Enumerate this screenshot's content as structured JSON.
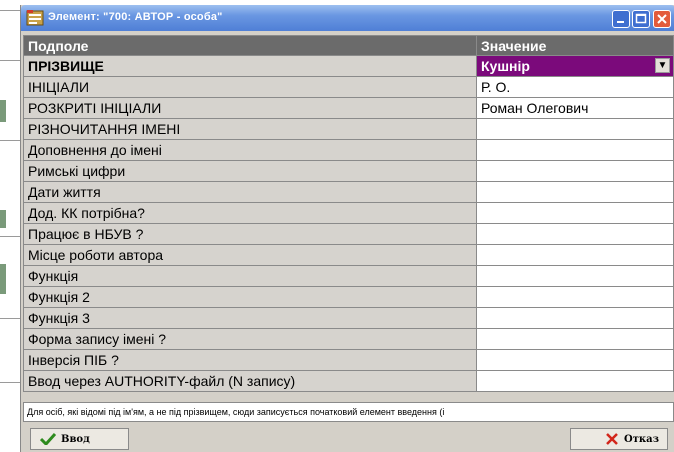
{
  "window": {
    "title": "Элемент: \"700: АВТОР - особа\""
  },
  "table": {
    "headers": {
      "field": "Подполе",
      "value": "Значение"
    },
    "rows": [
      {
        "field": "ПРІЗВИЩЕ",
        "value": "Кушнір"
      },
      {
        "field": "ІНІЦІАЛИ",
        "value": "Р. О."
      },
      {
        "field": "РОЗКРИТІ ІНІЦІАЛИ",
        "value": "Роман Олегович"
      },
      {
        "field": "РІЗНОЧИТАННЯ ІМЕНІ",
        "value": ""
      },
      {
        "field": "Доповнення до імені",
        "value": ""
      },
      {
        "field": "Римські цифри",
        "value": ""
      },
      {
        "field": "Дати життя",
        "value": ""
      },
      {
        "field": "Дод. КК потрібна?",
        "value": ""
      },
      {
        "field": "Працює в НБУВ ?",
        "value": ""
      },
      {
        "field": "Місце роботи автора",
        "value": ""
      },
      {
        "field": "Функція",
        "value": ""
      },
      {
        "field": "Функція 2",
        "value": ""
      },
      {
        "field": "Функція 3",
        "value": ""
      },
      {
        "field": "Форма запису імені ?",
        "value": ""
      },
      {
        "field": "Інверсія ПІБ ?",
        "value": ""
      },
      {
        "field": "Ввод через AUTHORITY-файл (N запису)",
        "value": ""
      }
    ]
  },
  "hint": "Для осіб, які відомі під ім'ям, а не під прізвищем, сюди записується початковий елемент введення (і",
  "buttons": {
    "ok": "Ввод",
    "cancel": "Отказ"
  },
  "colors": {
    "selected": "#7b0a7b",
    "header": "#6b6b6b",
    "title": "#4f7fd6"
  }
}
